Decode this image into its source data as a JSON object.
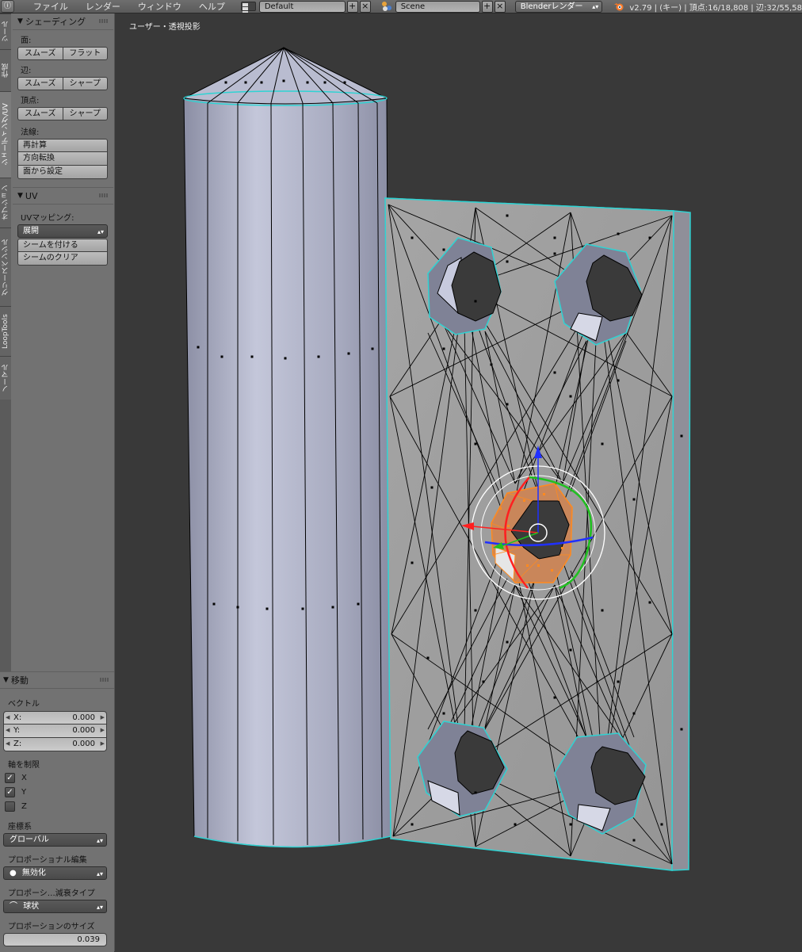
{
  "header": {
    "editor_icon": "info-icon",
    "menus": [
      "ファイル",
      "レンダー",
      "ウィンドウ",
      "ヘルプ"
    ],
    "screen_layout": "Default",
    "scene": "Scene",
    "add_symbol": "+",
    "close_symbol": "×",
    "render_engine": "Blenderレンダー",
    "stats": "v2.79 | (キー) | 頂点:16/18,808 | 辺:32/55,58"
  },
  "tabs": [
    "ツール",
    "作成",
    "シェーディング/UV",
    "オプション",
    "グリースペンシル",
    "LoopTools",
    "ノーマル"
  ],
  "shading_panel": {
    "title": "シェーディング",
    "face_label": "面:",
    "face_buttons": [
      "スムーズ",
      "フラット"
    ],
    "edge_label": "辺:",
    "edge_buttons": [
      "スムーズ",
      "シャープ"
    ],
    "vertex_label": "頂点:",
    "vertex_buttons": [
      "スムーズ",
      "シャープ"
    ],
    "normals_label": "法線:",
    "normals_buttons": [
      "再計算",
      "方向転換",
      "面から設定"
    ]
  },
  "uv_panel": {
    "title": "UV",
    "mapping_label": "UVマッピング:",
    "mapping_value": "展開",
    "buttons": [
      "シームを付ける",
      "シームのクリア"
    ]
  },
  "operator_panel": {
    "title": "移動",
    "vector_label": "ベクトル",
    "x_label": "X:",
    "x_value": "0.000",
    "y_label": "Y:",
    "y_value": "0.000",
    "z_label": "Z:",
    "z_value": "0.000",
    "constraint_label": "軸を制限",
    "axes": [
      {
        "label": "X",
        "checked": true
      },
      {
        "label": "Y",
        "checked": true
      },
      {
        "label": "Z",
        "checked": false
      }
    ],
    "orientation_label": "座標系",
    "orientation_value": "グローバル",
    "proportional_label": "プロポーショナル編集",
    "proportional_value": "無効化",
    "falloff_label": "プロポーシ…減衰タイプ",
    "falloff_value": "球状",
    "size_label": "プロポーションのサイズ",
    "size_value": "0.039"
  },
  "viewport": {
    "title": "ユーザー・透視投影",
    "colors": {
      "background": "#393939",
      "mesh": "#a9acc4",
      "plate": "#9c9c9c",
      "edge": "#000000",
      "outline": "#2fd3d3",
      "selected": "#ff8a1f",
      "axis_x": "#ff2020",
      "axis_y": "#20c020",
      "axis_z": "#2030ff"
    }
  }
}
